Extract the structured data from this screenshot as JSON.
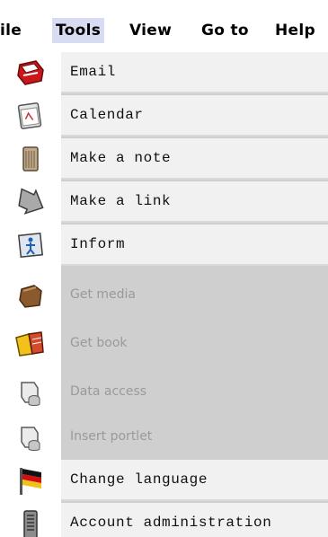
{
  "menubar": {
    "items": [
      {
        "label": "ile"
      },
      {
        "label": "Tools"
      },
      {
        "label": "View"
      },
      {
        "label": "Go to"
      },
      {
        "label": "Help"
      }
    ],
    "active_index": 1
  },
  "menu": {
    "items": [
      {
        "label": "Email",
        "icon": "email-icon",
        "enabled": true
      },
      {
        "label": "Calendar",
        "icon": "calendar-icon",
        "enabled": true
      },
      {
        "label": "Make a note",
        "icon": "note-icon",
        "enabled": true
      },
      {
        "label": "Make a link",
        "icon": "link-icon",
        "enabled": true
      },
      {
        "label": "Inform",
        "icon": "inform-icon",
        "enabled": true
      },
      {
        "label": "Get media",
        "icon": "media-icon",
        "enabled": false
      },
      {
        "label": "Get book",
        "icon": "book-icon",
        "enabled": false
      },
      {
        "label": "Data access",
        "icon": "data-access-icon",
        "enabled": false
      },
      {
        "label": "Insert portlet",
        "icon": "portlet-icon",
        "enabled": false
      },
      {
        "label": "Change language",
        "icon": "flag-icon",
        "enabled": true
      },
      {
        "label": "Account administration",
        "icon": "account-icon",
        "enabled": true
      }
    ]
  },
  "colors": {
    "active_menu_bg": "#d7dcf3",
    "item_bg": "#f1f1f1",
    "disabled_bg": "#cfcfcf",
    "disabled_text": "#9a9a9a"
  }
}
